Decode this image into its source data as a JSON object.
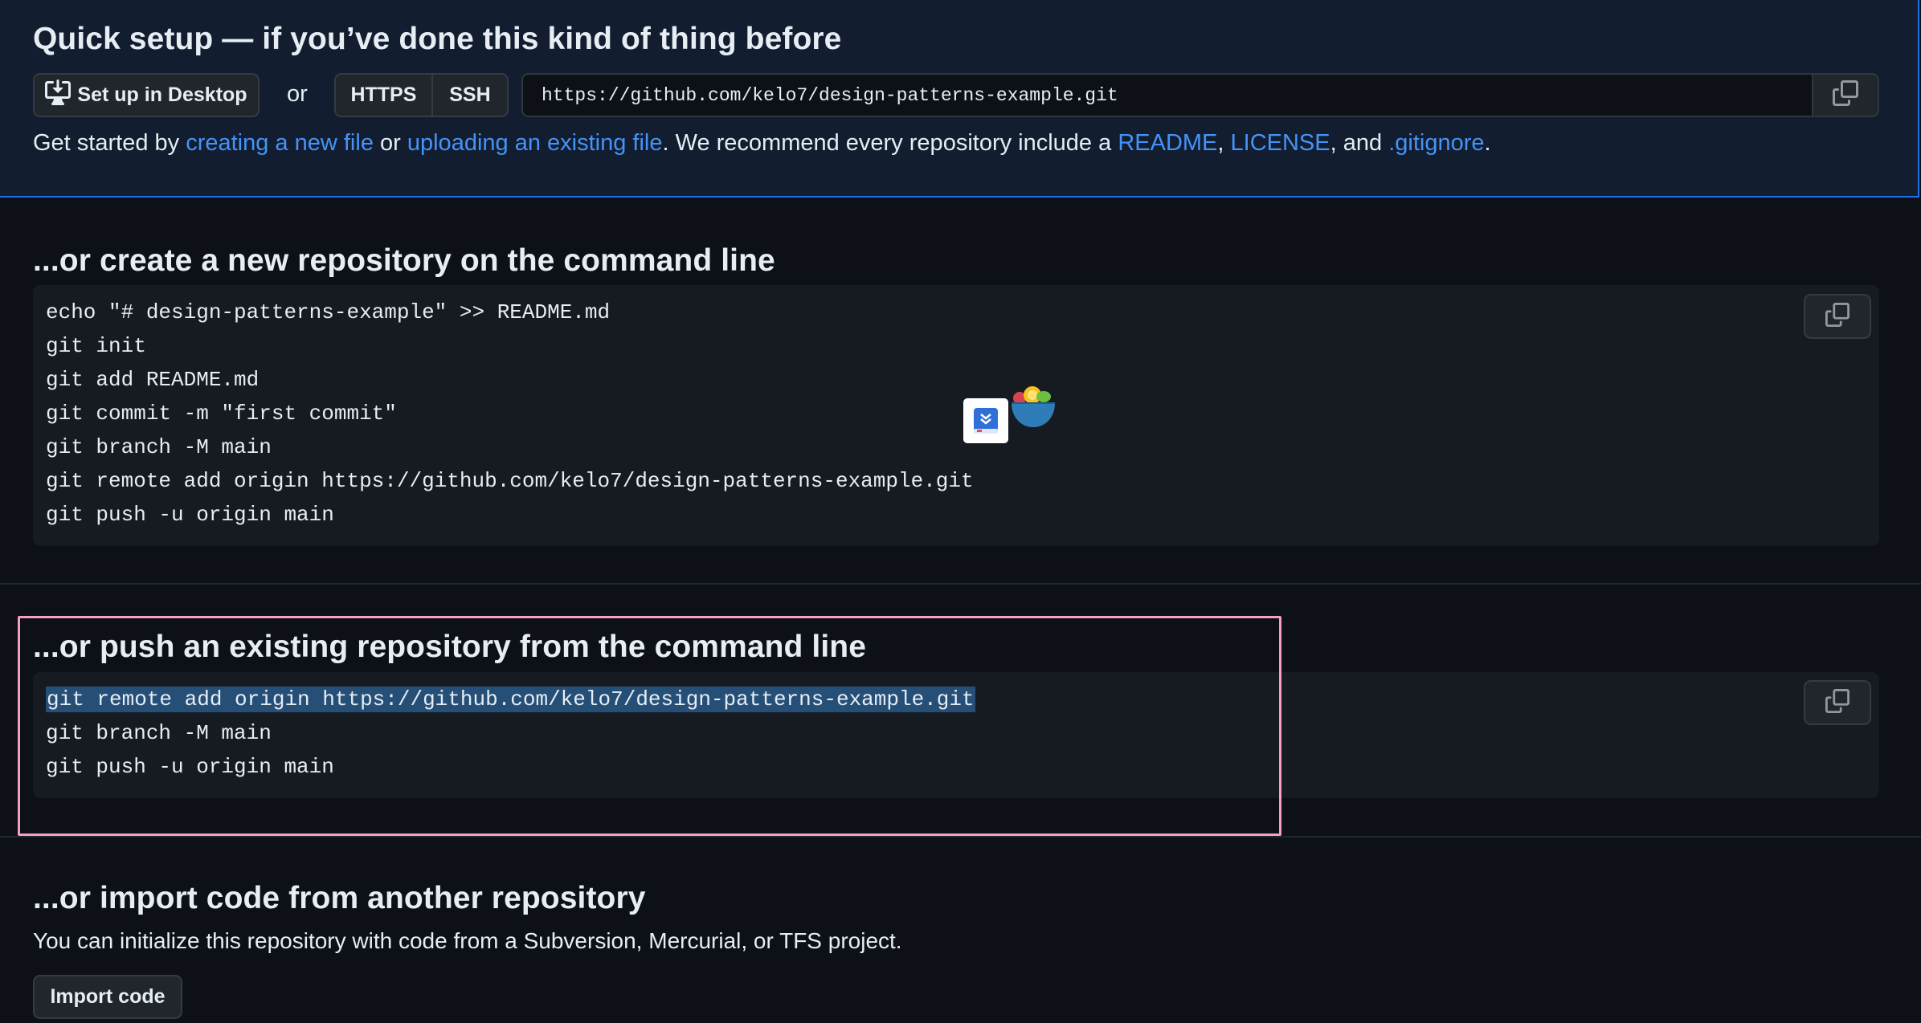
{
  "quick_setup": {
    "title": "Quick setup — if you’ve done this kind of thing before",
    "desktop_button": "Set up in Desktop",
    "or": "or",
    "https": "HTTPS",
    "ssh": "SSH",
    "url": "https://github.com/kelo7/design-patterns-example.git",
    "get_started": {
      "prefix": "Get started by ",
      "link_new_file": "creating a new file",
      "or": " or ",
      "link_upload": "uploading an existing file",
      "middle": ". We recommend every repository include a ",
      "link_readme": "README",
      "comma": ", ",
      "link_license": "LICENSE",
      "and": ", and ",
      "link_gitignore": ".gitignore",
      "period": "."
    }
  },
  "create_section": {
    "title": "...or create a new repository on the command line",
    "lines": [
      "echo \"# design-patterns-example\" >> README.md",
      "git init",
      "git add README.md",
      "git commit -m \"first commit\"",
      "git branch -M main",
      "git remote add origin https://github.com/kelo7/design-patterns-example.git",
      "git push -u origin main"
    ]
  },
  "push_section": {
    "title": "...or push an existing repository from the command line",
    "lines": [
      "git remote add origin https://github.com/kelo7/design-patterns-example.git",
      "git branch -M main",
      "git push -u origin main"
    ]
  },
  "import_section": {
    "title": "...or import code from another repository",
    "description": "You can initialize this repository with code from a Subversion, Mercurial, or TFS project.",
    "button": "Import code"
  },
  "icons": {
    "copy": "copy-icon",
    "desktop": "desktop-download-icon",
    "book_app": "book-app-icon",
    "bowl_app": "fruit-bowl-icon"
  },
  "colors": {
    "background": "#0d1117",
    "quick_setup_bg": "#121d2f",
    "link": "#4493f8",
    "selection": "#264f78",
    "highlight_frame": "#f5a0be"
  }
}
